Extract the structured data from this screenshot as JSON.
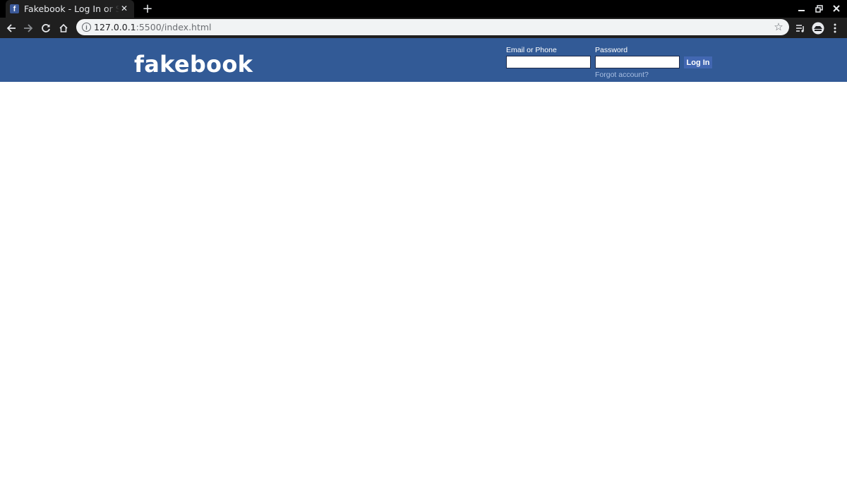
{
  "browser": {
    "tab": {
      "title": "Fakebook - Log In or Sign Up",
      "favicon": "f"
    },
    "new_tab_label": "+",
    "close_tab_label": "✕",
    "address": {
      "host": "127.0.0.1",
      "path": ":5500/index.html"
    },
    "icons": [
      "back-icon",
      "forward-icon",
      "reload-icon",
      "home-icon",
      "info-icon",
      "star-icon",
      "media-control-icon",
      "profile-icon",
      "menu-icon",
      "minimize-icon",
      "restore-icon",
      "close-window-icon"
    ]
  },
  "header": {
    "logo": "fakebook",
    "background_color": "#325a96",
    "email": {
      "label": "Email or Phone",
      "value": "",
      "placeholder": ""
    },
    "password": {
      "label": "Password",
      "value": "",
      "placeholder": ""
    },
    "login_button": "Log In",
    "forgot_link": "Forgot account?"
  }
}
